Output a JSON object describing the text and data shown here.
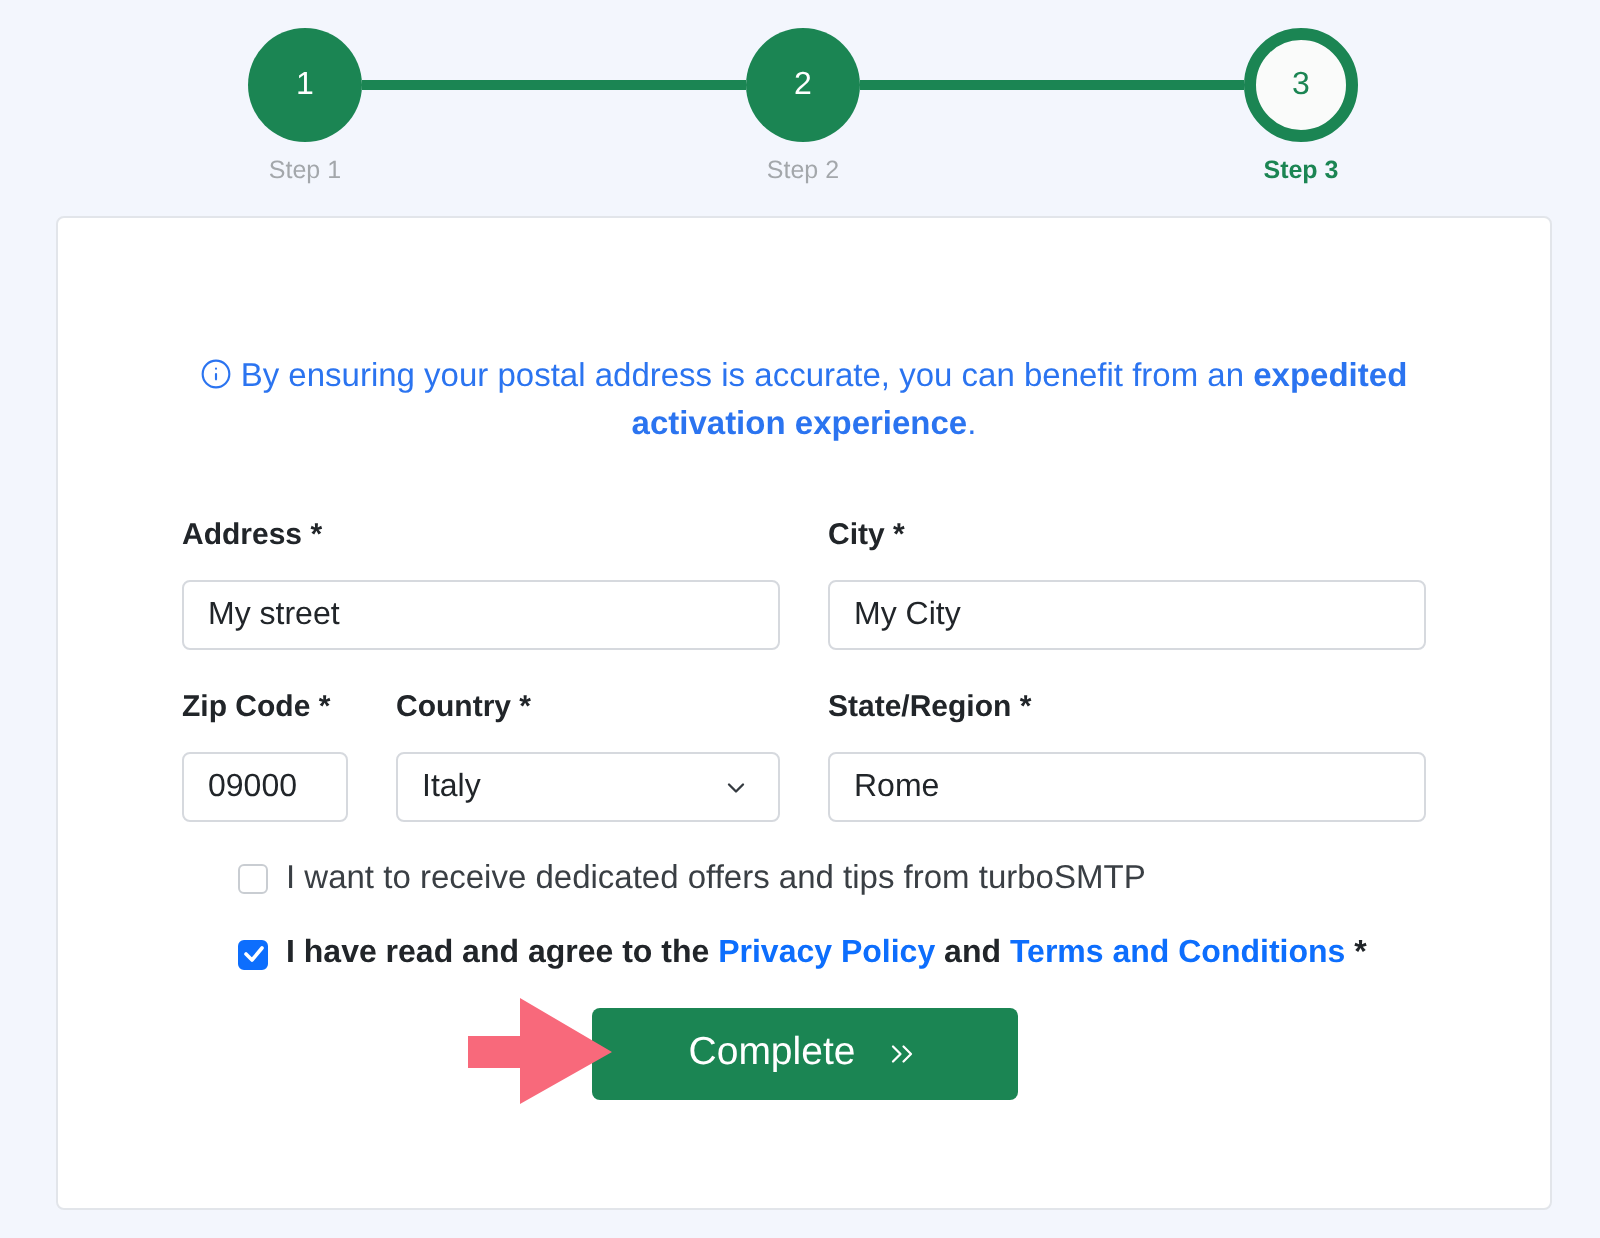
{
  "stepper": {
    "steps": [
      {
        "number": "1",
        "label": "Step 1",
        "selected": false
      },
      {
        "number": "2",
        "label": "Step 2",
        "selected": false
      },
      {
        "number": "3",
        "label": "Step 3",
        "selected": true
      }
    ]
  },
  "notice": {
    "text": "By ensuring your postal address is accurate, you can benefit from an **expedited activation experience**."
  },
  "form": {
    "fields": [
      {
        "kind": "text",
        "label": "Address *",
        "value": "My street"
      },
      {
        "kind": "text",
        "label": "City *",
        "value": "My City"
      },
      {
        "kind": "text",
        "label": "Zip Code *",
        "value": "09000"
      },
      {
        "kind": "select",
        "label": "Country *",
        "value": "Italy"
      },
      {
        "kind": "text",
        "label": "State/Region *",
        "value": "Rome"
      }
    ],
    "checkboxes": [
      {
        "checked": false,
        "bold": false,
        "parts": [
          {
            "kind": "text",
            "text": "I want to receive dedicated offers and tips from turboSMTP"
          }
        ]
      },
      {
        "checked": true,
        "bold": true,
        "parts": [
          {
            "kind": "text",
            "text": "I have read and agree to the"
          },
          {
            "kind": "link",
            "text": "Privacy Policy"
          },
          {
            "kind": "text",
            "text": "and"
          },
          {
            "kind": "link",
            "text": "Terms and Conditions"
          },
          {
            "kind": "text",
            "text": "*"
          }
        ]
      }
    ],
    "submit_button": {
      "label": "Complete"
    }
  }
}
